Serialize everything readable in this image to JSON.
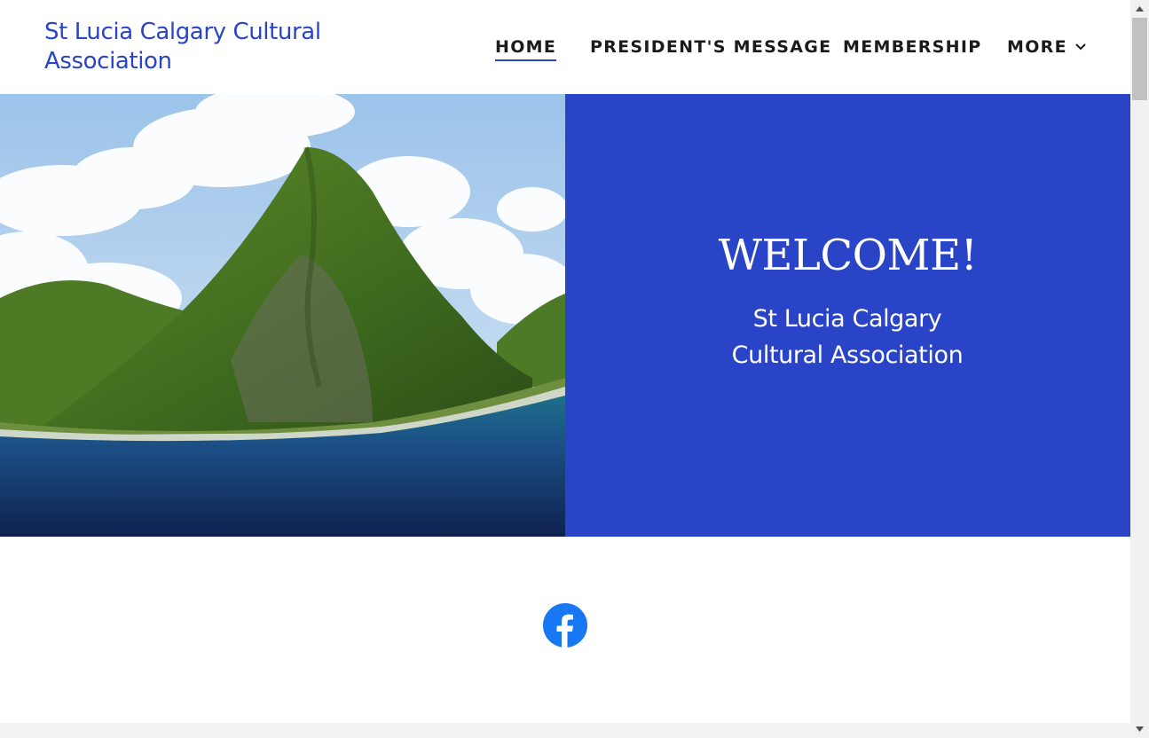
{
  "header": {
    "site_title": "St Lucia Calgary Cultural Association",
    "nav": [
      {
        "label": "HOME",
        "active": true
      },
      {
        "label": "PRESIDENT'S MESSAGE",
        "active": false
      },
      {
        "label": "MEMBERSHIP",
        "active": false
      },
      {
        "label": "MORE",
        "active": false,
        "icon": "chevron-down-icon"
      }
    ]
  },
  "hero": {
    "image": "pitons-mountain-sea-photo",
    "heading": "WELCOME!",
    "subheading": "St Lucia Calgary Cultural Association"
  },
  "social": {
    "icon": "facebook-icon"
  },
  "colors": {
    "accent": "#2a44c7",
    "nav_text": "#1b1b1b",
    "facebook": "#1877f2"
  }
}
